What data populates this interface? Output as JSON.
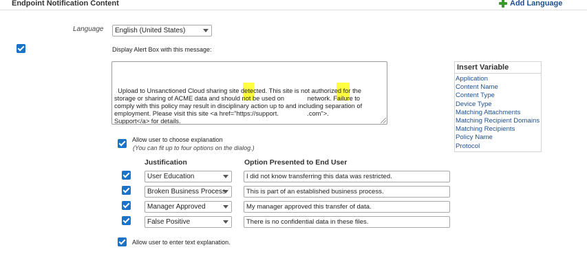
{
  "header": {
    "title": "Endpoint Notification Content",
    "add_language_label": "Add Language"
  },
  "language": {
    "label": "Language",
    "selected": "English (United States)"
  },
  "alert_box": {
    "checked": true,
    "label": "Display Alert Box with this message:",
    "message": "Upload to Unsanctioned Cloud sharing site detected. This site is not authorized for the\nstorage or sharing of ACME data and should not be used on             network. Failure to\ncomply with this policy may result in disciplinary action up to and including separation of\nemployment. Please visit this site <a href=\"https://support.                .com\">.\nSupport</a> for details."
  },
  "insert_variable": {
    "title": "Insert Variable",
    "items": [
      "Application",
      "Content Name",
      "Content Type",
      "Device Type",
      "Matching Attachments",
      "Matching Recipient Domains",
      "Matching Recipients",
      "Policy Name",
      "Protocol"
    ]
  },
  "allow_choose": {
    "checked": true,
    "label": "Allow user to choose explanation",
    "hint": "(You can fit up to four options on the dialog.)"
  },
  "justification_table": {
    "col_justification": "Justification",
    "col_option": "Option Presented to End User",
    "rows": [
      {
        "checked": true,
        "justification": "User Education",
        "option": "I did not know transferring this data was restricted."
      },
      {
        "checked": true,
        "justification": "Broken Business Process",
        "option": "This is part of an established business process."
      },
      {
        "checked": true,
        "justification": "Manager Approved",
        "option": "My manager approved this transfer of data."
      },
      {
        "checked": true,
        "justification": "False Positive",
        "option": "There is no confidential data in these files."
      }
    ]
  },
  "allow_text": {
    "checked": true,
    "label": "Allow user to enter text explanation."
  },
  "colors": {
    "checkbox": "#1a73c9",
    "link": "#1d4f91",
    "add_icon": "#3d9a2e",
    "highlight": "#ffff00"
  }
}
